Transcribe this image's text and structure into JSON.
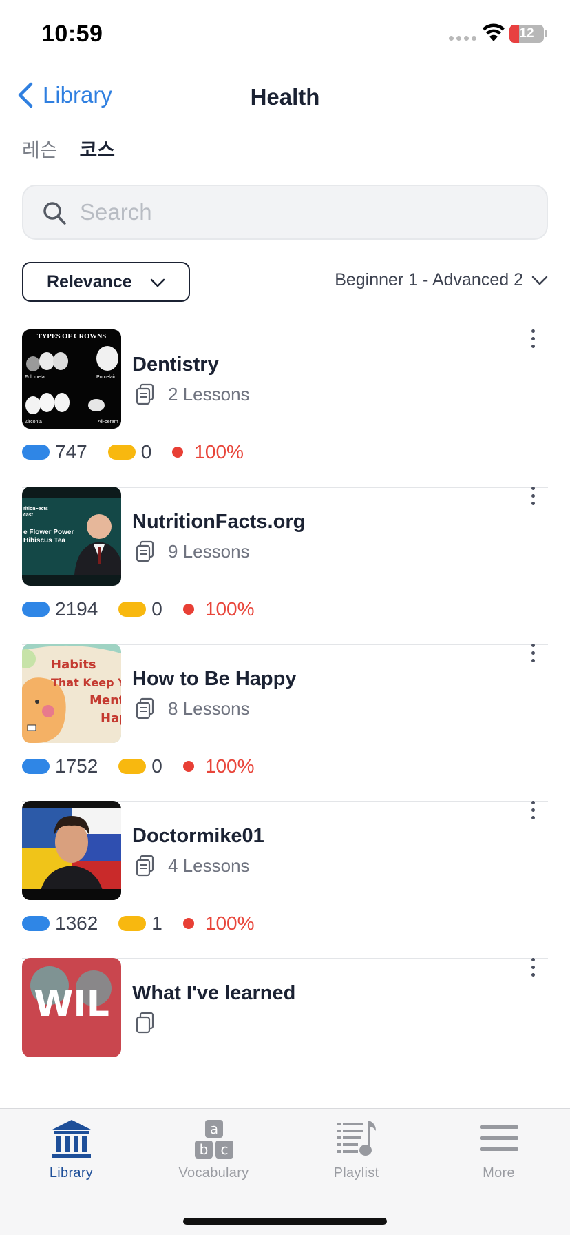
{
  "status_bar": {
    "time": "10:59",
    "battery": "12"
  },
  "nav": {
    "back_label": "Library",
    "title": "Health"
  },
  "tabs": [
    {
      "label": "레슨",
      "active": false
    },
    {
      "label": "코스",
      "active": true
    }
  ],
  "search": {
    "placeholder": "Search",
    "value": ""
  },
  "filters": {
    "sort_label": "Relevance",
    "level_label": "Beginner 1 - Advanced 2"
  },
  "courses": [
    {
      "title": "Dentistry",
      "lessons": "2 Lessons",
      "blue_count": "747",
      "yellow_count": "0",
      "percent": "100%",
      "thumbnail_text": "TYPES OF CROWNS"
    },
    {
      "title": "NutritionFacts.org",
      "lessons": "9 Lessons",
      "blue_count": "2194",
      "yellow_count": "0",
      "percent": "100%",
      "thumbnail_text": "e Flower Power Hibiscus Tea"
    },
    {
      "title": "How to Be Happy",
      "lessons": "8 Lessons",
      "blue_count": "1752",
      "yellow_count": "0",
      "percent": "100%",
      "thumbnail_text": "Habits That Keep Y Ment Hap"
    },
    {
      "title": "Doctormike01",
      "lessons": "4 Lessons",
      "blue_count": "1362",
      "yellow_count": "1",
      "percent": "100%"
    },
    {
      "title": "What I've learned",
      "thumbnail_text": "WIL"
    }
  ],
  "tab_bar": [
    {
      "label": "Library",
      "icon": "library-icon",
      "active": true
    },
    {
      "label": "Vocabulary",
      "icon": "vocabulary-icon",
      "active": false
    },
    {
      "label": "Playlist",
      "icon": "playlist-icon",
      "active": false
    },
    {
      "label": "More",
      "icon": "menu-icon",
      "active": false
    }
  ],
  "colors": {
    "accent": "#2f7fe0",
    "active_tab": "#1e4f99",
    "blue_pill": "#2f86e6",
    "yellow_pill": "#f8b80f",
    "red": "#e83f35"
  }
}
